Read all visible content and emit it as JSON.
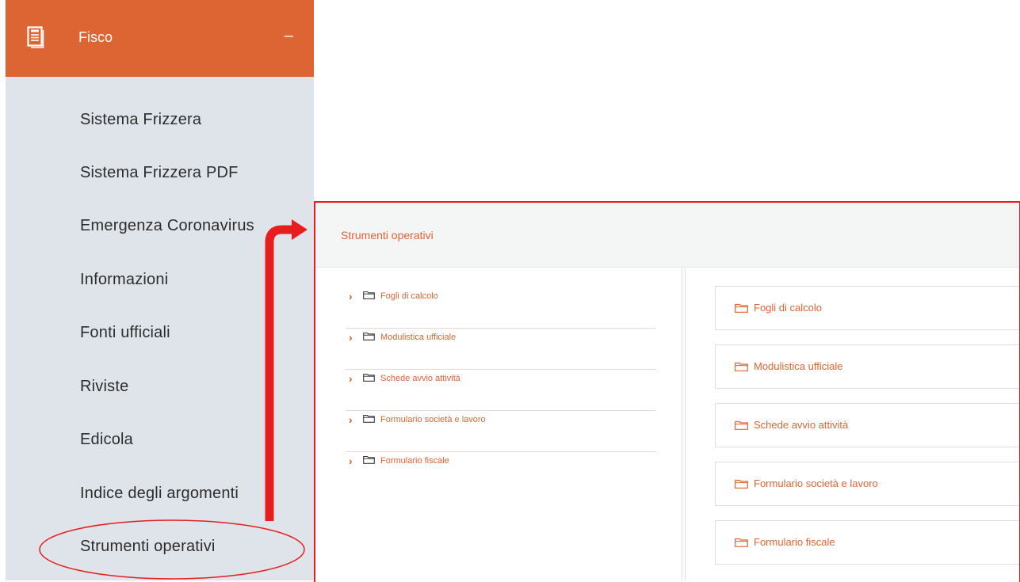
{
  "sidebar": {
    "header": {
      "title": "Fisco",
      "toggle": "–"
    },
    "items": [
      {
        "label": "Sistema Frizzera"
      },
      {
        "label": "Sistema Frizzera PDF"
      },
      {
        "label": "Emergenza Coronavirus"
      },
      {
        "label": "Informazioni"
      },
      {
        "label": "Fonti ufficiali"
      },
      {
        "label": "Riviste"
      },
      {
        "label": "Edicola"
      },
      {
        "label": "Indice degli argomenti"
      },
      {
        "label": "Strumenti operativi"
      }
    ]
  },
  "panel": {
    "title": "Strumenti operativi",
    "tree": [
      {
        "label": "Fogli di calcolo"
      },
      {
        "label": "Modulistica ufficiale"
      },
      {
        "label": "Schede avvio attività"
      },
      {
        "label": "Formulario società e lavoro"
      },
      {
        "label": "Formulario fiscale"
      }
    ],
    "cards": [
      {
        "label": "Fogli di calcolo"
      },
      {
        "label": "Modulistica ufficiale"
      },
      {
        "label": "Schede avvio attività"
      },
      {
        "label": "Formulario società e lavoro"
      },
      {
        "label": "Formulario fiscale"
      }
    ]
  },
  "colors": {
    "accent": "#dd6533",
    "sidebar_bg": "#dfe3ea",
    "annotation_red": "#e81d1d"
  },
  "icons": [
    "document-icon",
    "folder-icon",
    "chevron-right-icon"
  ]
}
